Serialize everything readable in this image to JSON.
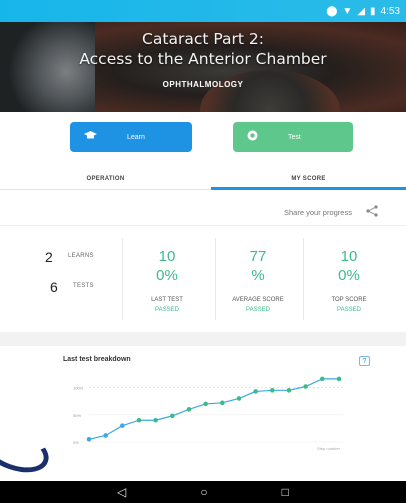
{
  "status_bar": {
    "time": "4:53"
  },
  "header": {
    "title_line1": "Cataract Part 2:",
    "title_line2": "Access to the Anterior Chamber",
    "category": "OPHTHALMOLOGY"
  },
  "actions": {
    "learn_label": "Learn",
    "test_label": "Test"
  },
  "tabs": [
    {
      "label": "OPERATION"
    },
    {
      "label": "MY SCORE"
    }
  ],
  "share": {
    "label": "Share your progress"
  },
  "counts": {
    "learns_value": "2",
    "learns_label": "LEARNS",
    "tests_value": "6",
    "tests_label": "TESTS"
  },
  "stats": [
    {
      "value": "10",
      "percent": "0%",
      "caption": "LAST TEST",
      "status": "PASSED"
    },
    {
      "value": "77",
      "percent": "%",
      "caption": "AVERAGE SCORE",
      "status": "PASSED"
    },
    {
      "value": "10",
      "percent": "0%",
      "caption": "TOP SCORE",
      "status": "PASSED"
    }
  ],
  "breakdown": {
    "title": "Last test breakdown",
    "help_label": "?"
  },
  "chart_data": {
    "type": "line",
    "x": [
      1,
      2,
      3,
      4,
      5,
      6,
      7,
      8,
      9,
      10,
      11,
      12,
      13,
      14,
      15,
      16
    ],
    "values": [
      5,
      12,
      30,
      40,
      40,
      48,
      60,
      70,
      72,
      80,
      93,
      95,
      95,
      102,
      116,
      116
    ],
    "ylim": [
      0,
      125
    ],
    "ytick_labels": [
      "0%",
      "50%",
      "100%"
    ],
    "xlabel": "Step number",
    "ylabel": "",
    "title": "",
    "grid": true,
    "line_color": "#3aa9e8",
    "marker_color": "#3dba8a"
  },
  "colors": {
    "learn": "#1e93e4",
    "test": "#5ec78c",
    "accent_green": "#3dba8a",
    "status_bar": "#17b6ea"
  },
  "nav": {
    "back_icon": "◁",
    "home_icon": "○",
    "recent_icon": "□"
  }
}
